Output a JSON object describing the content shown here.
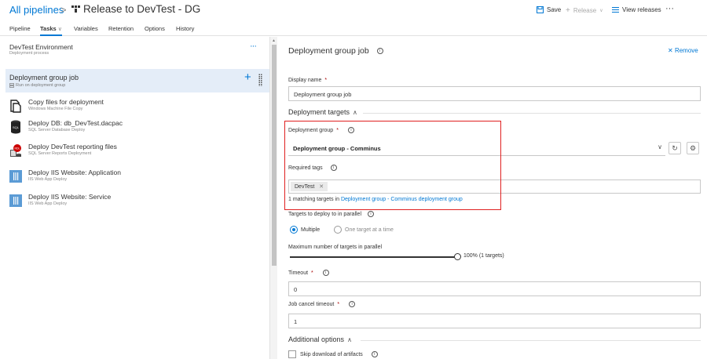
{
  "header": {
    "breadcrumb_root": "All pipelines",
    "separator": ">",
    "title": "Release to DevTest - DG",
    "save_label": "Save",
    "release_label": "Release",
    "view_releases_label": "View releases",
    "more_label": "···"
  },
  "tabs": [
    {
      "label": "Pipeline"
    },
    {
      "label": "Tasks",
      "active": true
    },
    {
      "label": "Variables"
    },
    {
      "label": "Retention"
    },
    {
      "label": "Options"
    },
    {
      "label": "History"
    }
  ],
  "stage": {
    "name": "DevTest Environment",
    "subtitle": "Deployment process",
    "more_label": "···"
  },
  "job": {
    "title": "Deployment group job",
    "subtitle": "Run on deployment group",
    "add_label": "+"
  },
  "tasks": [
    {
      "title": "Copy files for deployment",
      "subtitle": "Windows Machine File Copy",
      "icon": "file-copy-icon"
    },
    {
      "title": "Deploy DB: db_DevTest.dacpac",
      "subtitle": "SQL Server Database Deploy",
      "icon": "sql-database-icon"
    },
    {
      "title": "Deploy DevTest reporting files",
      "subtitle": "SQL Server Reports Deployment",
      "icon": "sql-reports-icon"
    },
    {
      "title": "Deploy IIS Website: Application",
      "subtitle": "IIS Web App Deploy",
      "icon": "iis-icon"
    },
    {
      "title": "Deploy IIS Website: Service",
      "subtitle": "IIS Web App Deploy",
      "icon": "iis-icon"
    }
  ],
  "panel": {
    "title": "Deployment group job",
    "remove_label": "Remove",
    "display_name_label": "Display name",
    "display_name_value": "Deployment group job",
    "deployment_targets_label": "Deployment targets",
    "deployment_group_label": "Deployment group",
    "deployment_group_value": "Deployment group - Comminus",
    "required_tags_label": "Required tags",
    "tag_value": "DevTest",
    "matching_prefix": "1 matching targets in",
    "matching_link": "Deployment group - Comminus deployment group",
    "targets_parallel_label": "Targets to deploy to in parallel",
    "radio_multiple": "Multiple",
    "radio_one": "One target at a time",
    "max_targets_label": "Maximum number of targets in parallel",
    "max_targets_value": "100% (1 targets)",
    "max_targets_fraction": 1.0,
    "timeout_label": "Timeout",
    "timeout_value": "0",
    "job_cancel_label": "Job cancel timeout",
    "job_cancel_value": "1",
    "additional_options_label": "Additional options",
    "skip_download_label": "Skip download of artifacts"
  },
  "colors": {
    "accent": "#0078d4",
    "highlight_border": "#e02020",
    "selected_row": "#e4edf8"
  }
}
